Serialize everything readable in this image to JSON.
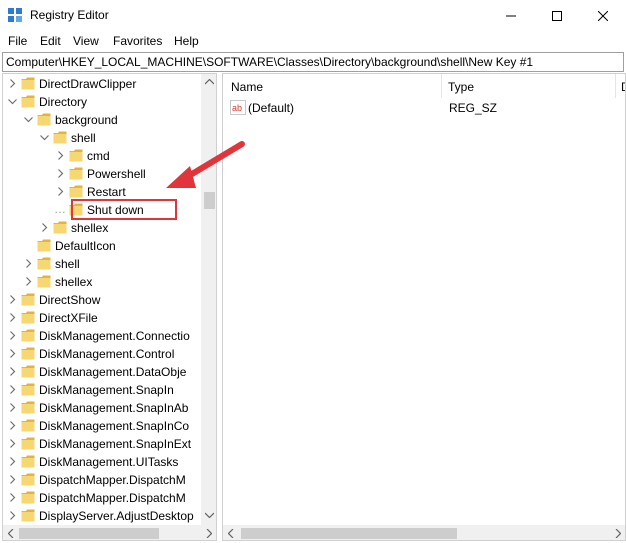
{
  "window": {
    "title": "Registry Editor",
    "icon": "registry-editor-icon",
    "controls": [
      "minimize-icon",
      "maximize-icon",
      "close-icon"
    ]
  },
  "menu": [
    "File",
    "Edit",
    "View",
    "Favorites",
    "Help"
  ],
  "address": "Computer\\HKEY_LOCAL_MACHINE\\SOFTWARE\\Classes\\Directory\\background\\shell\\New Key #1",
  "tree": [
    {
      "label": "DirectDrawClipper",
      "depth": 1,
      "expander": "collapsed"
    },
    {
      "label": "Directory",
      "depth": 1,
      "expander": "expanded"
    },
    {
      "label": "background",
      "depth": 2,
      "expander": "expanded"
    },
    {
      "label": "shell",
      "depth": 3,
      "expander": "expanded"
    },
    {
      "label": "cmd",
      "depth": 4,
      "expander": "collapsed"
    },
    {
      "label": "Powershell",
      "depth": 4,
      "expander": "collapsed"
    },
    {
      "label": "Restart",
      "depth": 4,
      "expander": "collapsed"
    },
    {
      "label": "Shut down",
      "depth": 4,
      "expander": "none"
    },
    {
      "label": "shellex",
      "depth": 3,
      "expander": "collapsed"
    },
    {
      "label": "DefaultIcon",
      "depth": 2,
      "expander": "none"
    },
    {
      "label": "shell",
      "depth": 2,
      "expander": "collapsed"
    },
    {
      "label": "shellex",
      "depth": 2,
      "expander": "collapsed"
    },
    {
      "label": "DirectShow",
      "depth": 1,
      "expander": "collapsed"
    },
    {
      "label": "DirectXFile",
      "depth": 1,
      "expander": "collapsed"
    },
    {
      "label": "DiskManagement.Connectio",
      "depth": 1,
      "expander": "collapsed"
    },
    {
      "label": "DiskManagement.Control",
      "depth": 1,
      "expander": "collapsed"
    },
    {
      "label": "DiskManagement.DataObje",
      "depth": 1,
      "expander": "collapsed"
    },
    {
      "label": "DiskManagement.SnapIn",
      "depth": 1,
      "expander": "collapsed"
    },
    {
      "label": "DiskManagement.SnapInAb",
      "depth": 1,
      "expander": "collapsed"
    },
    {
      "label": "DiskManagement.SnapInCo",
      "depth": 1,
      "expander": "collapsed"
    },
    {
      "label": "DiskManagement.SnapInExt",
      "depth": 1,
      "expander": "collapsed"
    },
    {
      "label": "DiskManagement.UITasks",
      "depth": 1,
      "expander": "collapsed"
    },
    {
      "label": "DispatchMapper.DispatchM",
      "depth": 1,
      "expander": "collapsed"
    },
    {
      "label": "DispatchMapper.DispatchM",
      "depth": 1,
      "expander": "collapsed"
    },
    {
      "label": "DisplayServer.AdjustDesktop",
      "depth": 1,
      "expander": "collapsed"
    }
  ],
  "list": {
    "columns": [
      "Name",
      "Type",
      "D"
    ],
    "rows": [
      {
        "name": "(Default)",
        "type": "REG_SZ",
        "icon": "string-value-icon"
      }
    ]
  },
  "annotation": {
    "highlighted_item": "Shut down",
    "arrow_color": "#e0353a",
    "box_color": "#e0353a"
  },
  "colors": {
    "folder": "#f7d674",
    "folder_dark": "#e2b43c",
    "scrollbar_track": "#f0f0f0",
    "scrollbar_thumb": "#cdcdcd"
  }
}
